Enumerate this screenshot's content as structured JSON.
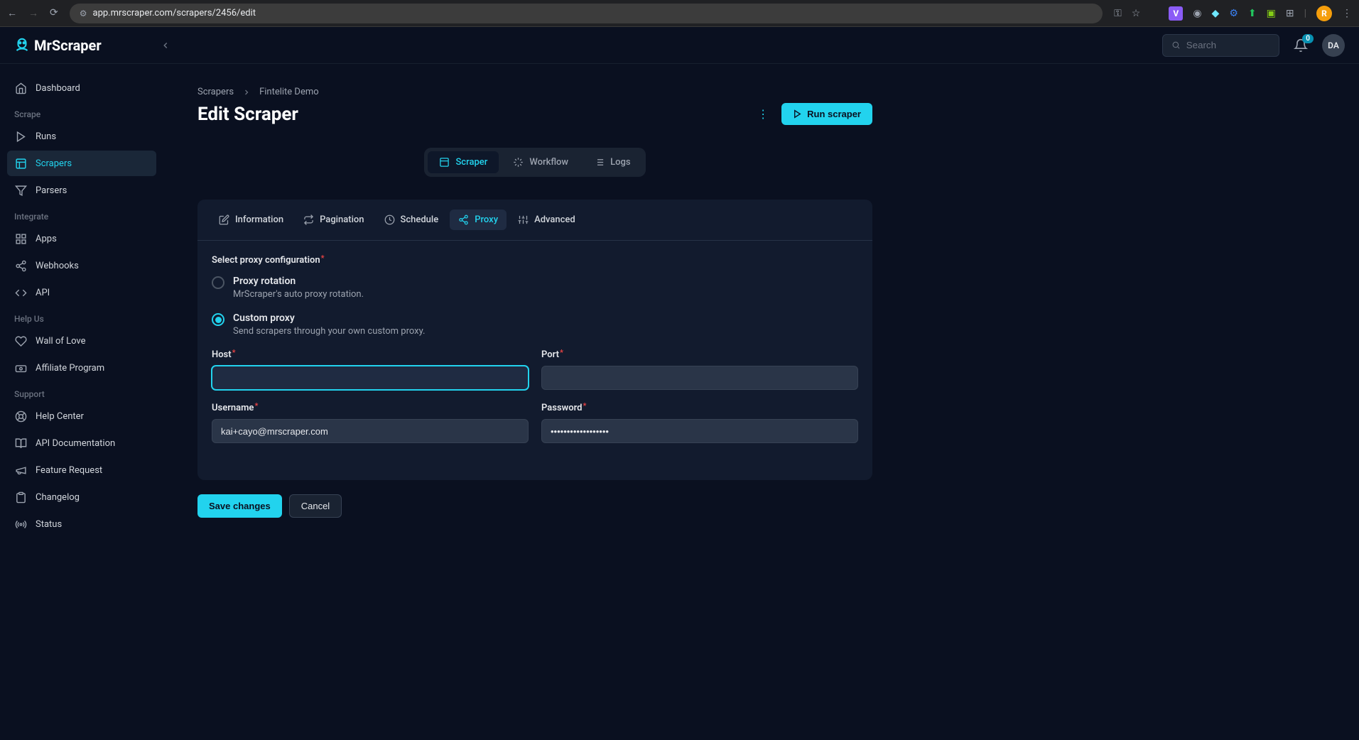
{
  "browser": {
    "url": "app.mrscraper.com/scrapers/2456/edit"
  },
  "app": {
    "name": "MrScraper",
    "search_placeholder": "Search",
    "notification_count": "0",
    "user_initials": "DA"
  },
  "sidebar": {
    "dashboard_label": "Dashboard",
    "groups": [
      {
        "label": "Scrape",
        "items": [
          {
            "label": "Runs"
          },
          {
            "label": "Scrapers"
          },
          {
            "label": "Parsers"
          }
        ]
      },
      {
        "label": "Integrate",
        "items": [
          {
            "label": "Apps"
          },
          {
            "label": "Webhooks"
          },
          {
            "label": "API"
          }
        ]
      },
      {
        "label": "Help Us",
        "items": [
          {
            "label": "Wall of Love"
          },
          {
            "label": "Affiliate Program"
          }
        ]
      },
      {
        "label": "Support",
        "items": [
          {
            "label": "Help Center"
          },
          {
            "label": "API Documentation"
          },
          {
            "label": "Feature Request"
          },
          {
            "label": "Changelog"
          },
          {
            "label": "Status"
          }
        ]
      }
    ]
  },
  "breadcrumb": {
    "parent": "Scrapers",
    "current": "Fintelite Demo"
  },
  "page": {
    "title": "Edit Scraper",
    "run_btn": "Run scraper"
  },
  "view_tabs": {
    "scraper": "Scraper",
    "workflow": "Workflow",
    "logs": "Logs"
  },
  "card_tabs": {
    "information": "Information",
    "pagination": "Pagination",
    "schedule": "Schedule",
    "proxy": "Proxy",
    "advanced": "Advanced"
  },
  "form": {
    "section_label": "Select proxy configuration",
    "options": {
      "rotation_title": "Proxy rotation",
      "rotation_desc": "MrScraper's auto proxy rotation.",
      "custom_title": "Custom proxy",
      "custom_desc": "Send scrapers through your own custom proxy."
    },
    "fields": {
      "host_label": "Host",
      "host_value": "",
      "port_label": "Port",
      "port_value": "",
      "username_label": "Username",
      "username_value": "kai+cayo@mrscraper.com",
      "password_label": "Password",
      "password_value": "••••••••••••••••••"
    },
    "save_btn": "Save changes",
    "cancel_btn": "Cancel"
  }
}
